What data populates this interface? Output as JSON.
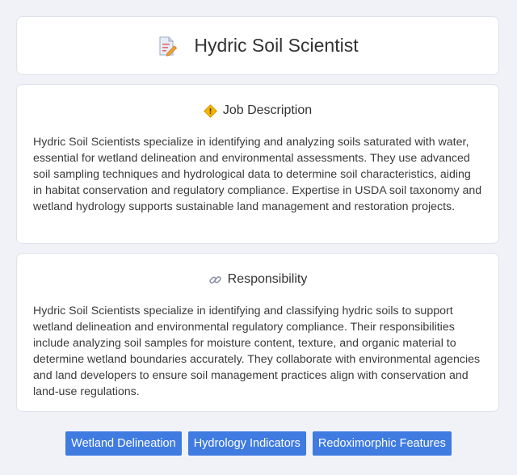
{
  "header": {
    "title": "Hydric Soil Scientist",
    "icon": "document-pencil-icon"
  },
  "job_description": {
    "heading": "Job Description",
    "icon": "diamond-warning-icon",
    "text": "Hydric Soil Scientists specialize in identifying and analyzing soils saturated with water, essential for wetland delineation and environmental assessments. They use advanced soil sampling techniques and hydrological data to determine soil characteristics, aiding in habitat conservation and regulatory compliance. Expertise in USDA soil taxonomy and wetland hydrology supports sustainable land management and restoration projects."
  },
  "responsibility": {
    "heading": "Responsibility",
    "icon": "link-icon",
    "text": "Hydric Soil Scientists specialize in identifying and classifying hydric soils to support wetland delineation and environmental regulatory compliance. Their responsibilities include analyzing soil samples for moisture content, texture, and organic material to determine wetland boundaries accurately. They collaborate with environmental agencies and land developers to ensure soil management practices align with conservation and land-use regulations."
  },
  "tags": [
    "Wetland Delineation",
    "Hydrology Indicators",
    "Redoximorphic Features"
  ],
  "colors": {
    "background": "#f0f2f8",
    "card": "#ffffff",
    "tag": "#3f7be0"
  }
}
